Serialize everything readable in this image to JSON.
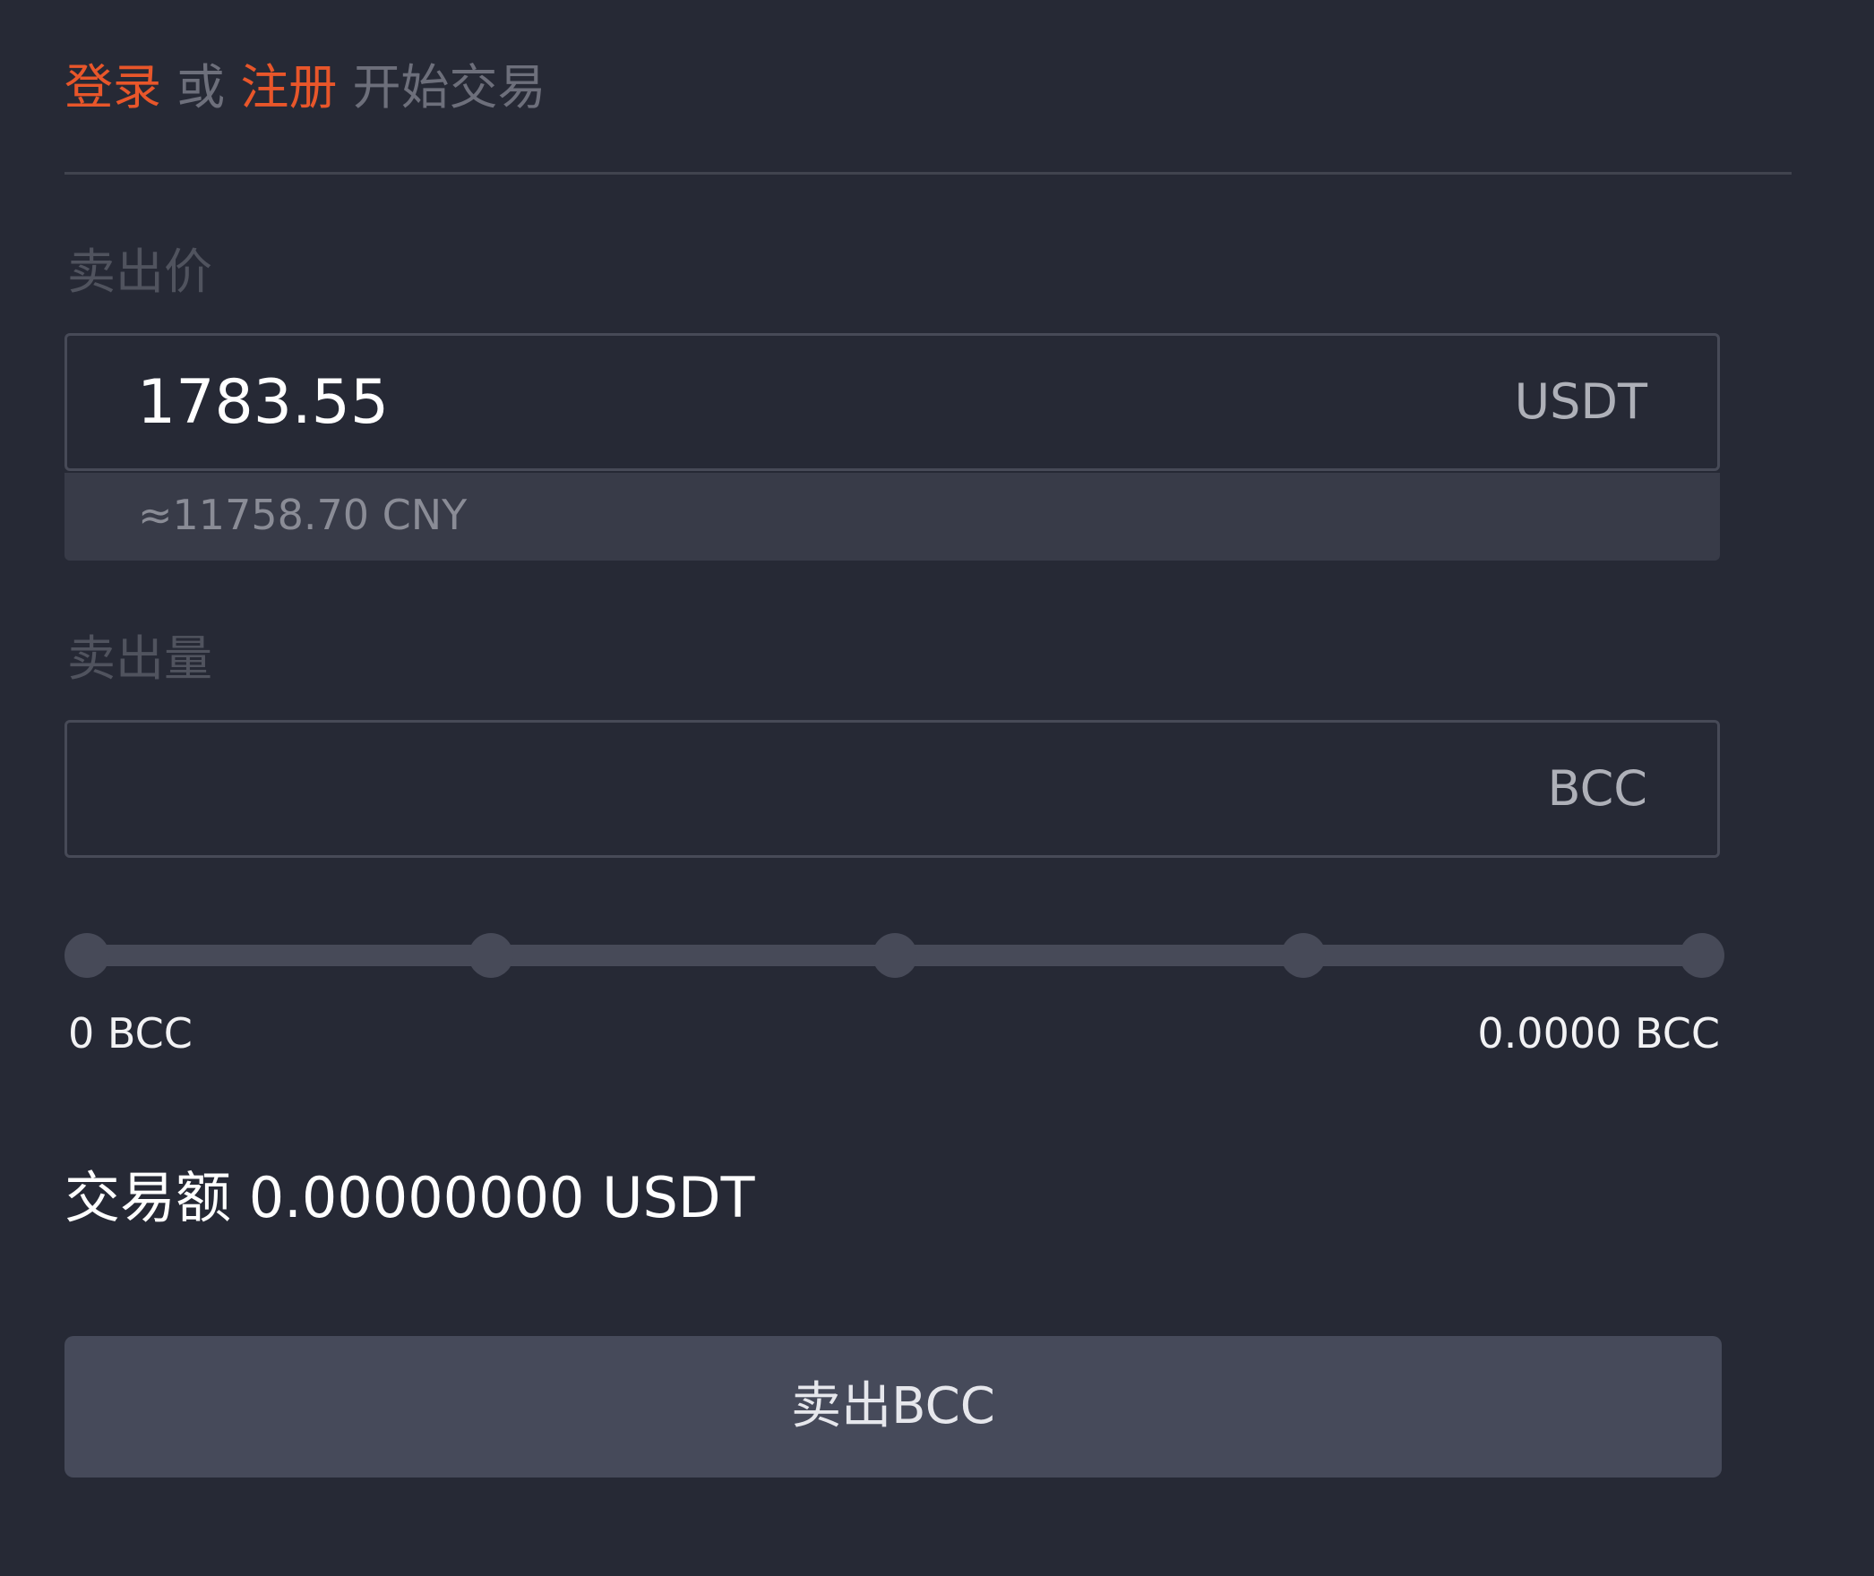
{
  "header": {
    "login_label": "登录",
    "or_text": "或",
    "register_label": "注册",
    "start_text": "开始交易"
  },
  "price": {
    "label": "卖出价",
    "value": "1783.55",
    "unit": "USDT",
    "cny_estimate": "≈11758.70 CNY"
  },
  "amount": {
    "label": "卖出量",
    "value": "",
    "placeholder": "",
    "unit": "BCC"
  },
  "slider": {
    "level_percent": 0,
    "min_label": "0 BCC",
    "max_label": "0.0000 BCC"
  },
  "total": {
    "label": "交易额",
    "value": "0.00000000 USDT"
  },
  "submit": {
    "label": "卖出BCC"
  },
  "colors": {
    "background": "#262935",
    "accent": "#e8562a",
    "button": "#464a5a"
  }
}
